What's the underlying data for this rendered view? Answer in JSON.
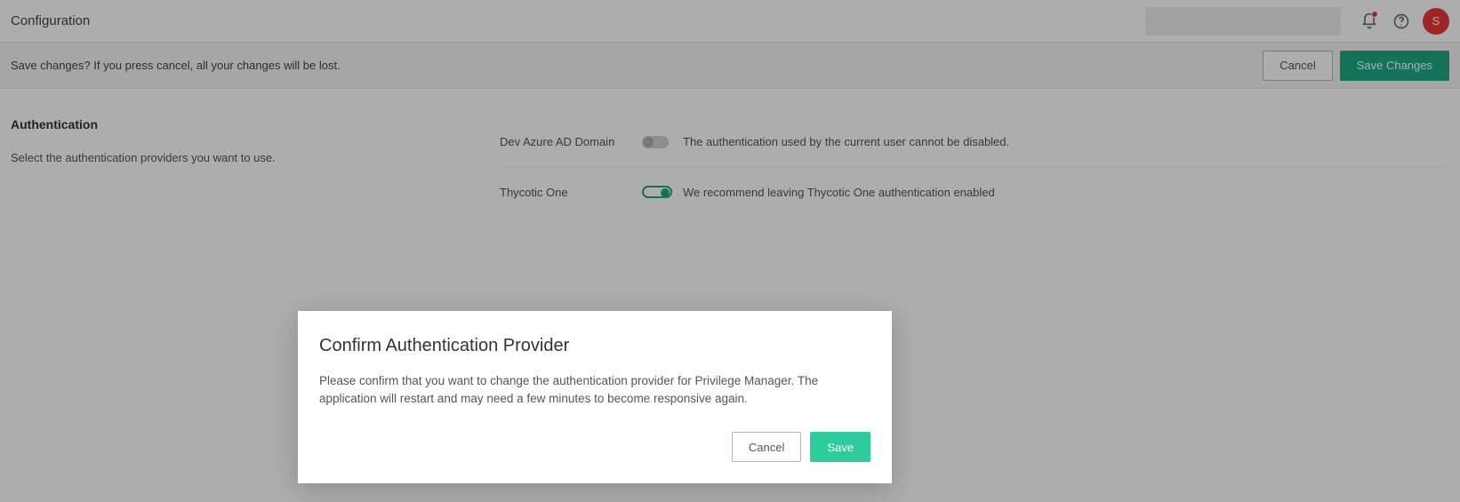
{
  "header": {
    "title": "Configuration",
    "search_placeholder": "",
    "avatar_letter": "S"
  },
  "banner": {
    "message": "Save changes? If you press cancel, all your changes will be lost.",
    "cancel_label": "Cancel",
    "save_label": "Save Changes"
  },
  "section": {
    "title": "Authentication",
    "description": "Select the authentication providers you want to use."
  },
  "settings": [
    {
      "label": "Dev Azure AD Domain",
      "enabled": false,
      "description": "The authentication used by the current user cannot be disabled."
    },
    {
      "label": "Thycotic One",
      "enabled": true,
      "description": "We recommend leaving Thycotic One authentication enabled"
    }
  ],
  "modal": {
    "title": "Confirm Authentication Provider",
    "body": "Please confirm that you want to change the authentication provider for Privilege Manager. The application will restart and may need a few minutes to become responsive again.",
    "cancel_label": "Cancel",
    "save_label": "Save"
  }
}
